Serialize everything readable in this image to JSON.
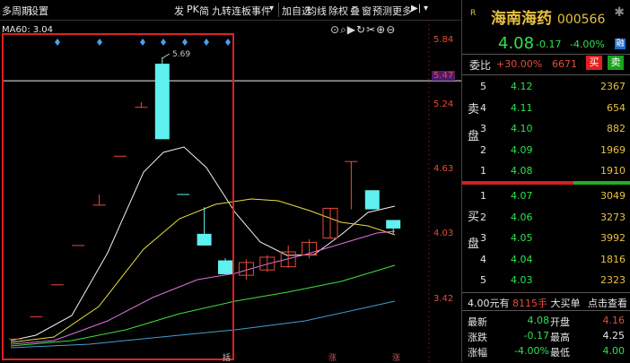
{
  "toolbar": {
    "left_items": [
      "多周期",
      "设置"
    ],
    "mid_items": [
      "发",
      "PK",
      "简",
      "九转",
      "连板",
      "事件"
    ],
    "right_items": [
      "加自选",
      "均线",
      "除权",
      "叠",
      "窗",
      "预测",
      "更多"
    ]
  },
  "chart": {
    "ma_label": "MA60: 3.04",
    "high_label": "5.69",
    "price_labels": [
      "5.84",
      "5.47",
      "5.24",
      "4.63",
      "4.03",
      "3.42"
    ],
    "tool_icons": [
      "circle-icon",
      "magnifier-icon",
      "play-icon",
      "refresh-icon",
      "scissors-icon",
      "plus-icon",
      "minus-icon"
    ],
    "bottom_labels": [
      "括",
      "涨",
      "涨"
    ]
  },
  "chart_data": {
    "type": "candlestick",
    "y_ticks": [
      5.84,
      5.47,
      5.24,
      4.63,
      4.03,
      3.42
    ],
    "reference_line": 5.47,
    "ma_line_label": "MA60: 3.04",
    "annotated_high": 5.69,
    "candles": [
      {
        "open": 3.04,
        "close": 3.04,
        "high": 3.04,
        "low": 3.04
      },
      {
        "open": 3.25,
        "close": 3.25,
        "high": 3.25,
        "low": 3.25
      },
      {
        "open": 3.55,
        "close": 3.55,
        "high": 3.55,
        "low": 3.55
      },
      {
        "open": 3.92,
        "close": 3.92,
        "high": 3.92,
        "low": 3.92
      },
      {
        "open": 4.3,
        "close": 4.3,
        "high": 4.4,
        "low": 4.3
      },
      {
        "open": 4.76,
        "close": 4.76,
        "high": 4.76,
        "low": 4.76
      },
      {
        "open": 5.22,
        "close": 5.22,
        "high": 5.27,
        "low": 5.22
      },
      {
        "open": 5.63,
        "close": 4.92,
        "high": 5.69,
        "low": 4.92
      },
      {
        "open": 4.4,
        "close": 4.4,
        "high": 4.4,
        "low": 4.4
      },
      {
        "open": 4.03,
        "close": 3.92,
        "high": 4.28,
        "low": 3.92
      },
      {
        "open": 3.78,
        "close": 3.65,
        "high": 3.8,
        "low": 3.65
      },
      {
        "open": 3.64,
        "close": 3.76,
        "high": 3.79,
        "low": 3.6
      },
      {
        "open": 3.69,
        "close": 3.81,
        "high": 3.83,
        "low": 3.67
      },
      {
        "open": 3.72,
        "close": 3.86,
        "high": 3.92,
        "low": 3.71
      },
      {
        "open": 3.83,
        "close": 3.95,
        "high": 3.98,
        "low": 3.8
      },
      {
        "open": 3.99,
        "close": 4.27,
        "high": 4.27,
        "low": 3.99
      },
      {
        "open": 4.71,
        "close": 4.71,
        "high": 4.71,
        "low": 4.26
      },
      {
        "open": 4.44,
        "close": 4.26,
        "high": 4.44,
        "low": 4.26
      },
      {
        "open": 4.16,
        "close": 4.08,
        "high": 4.16,
        "low": 4.03
      }
    ]
  },
  "panel": {
    "logo": "R",
    "name": "海南海药",
    "code": "000566",
    "price": "4.08",
    "change": "-0.17",
    "change_pct": "-4.00%",
    "rong_badge": "融",
    "weibi_label": "委比",
    "weibi_pct": "+30.00%",
    "weibi_diff": "6671",
    "buy_btn": "买",
    "sell_btn": "卖",
    "sell_side_label": [
      "卖",
      "盘"
    ],
    "buy_side_label": [
      "买",
      "盘"
    ],
    "sell_rows": [
      {
        "n": "5",
        "p": "4.12",
        "q": "2367"
      },
      {
        "n": "4",
        "p": "4.11",
        "q": "654"
      },
      {
        "n": "3",
        "p": "4.10",
        "q": "882"
      },
      {
        "n": "2",
        "p": "4.09",
        "q": "1969"
      },
      {
        "n": "1",
        "p": "4.08",
        "q": "1910"
      }
    ],
    "buy_rows": [
      {
        "n": "1",
        "p": "4.07",
        "q": "3049"
      },
      {
        "n": "2",
        "p": "4.06",
        "q": "3273"
      },
      {
        "n": "3",
        "p": "4.05",
        "q": "3992"
      },
      {
        "n": "4",
        "p": "4.04",
        "q": "1816"
      },
      {
        "n": "5",
        "p": "4.03",
        "q": "2323"
      }
    ],
    "big_order": {
      "price": "4.00",
      "unit": "元有",
      "qty": "8115手",
      "label": "大买单",
      "action": "点击查看"
    },
    "stats": [
      {
        "l1": "最新",
        "v1": "4.08",
        "l2": "开盘",
        "v2": "4.16"
      },
      {
        "l1": "涨跌",
        "v1": "-0.17",
        "l2": "最高",
        "v2": "4.25"
      },
      {
        "l1": "涨幅",
        "v1": "-4.00%",
        "l2": "最低",
        "v2": "4.00"
      }
    ]
  },
  "colors": {
    "up": "#e84a3a",
    "down": "#2fe04f",
    "cyan": "#5ff0f0",
    "gold": "#e8c040"
  }
}
